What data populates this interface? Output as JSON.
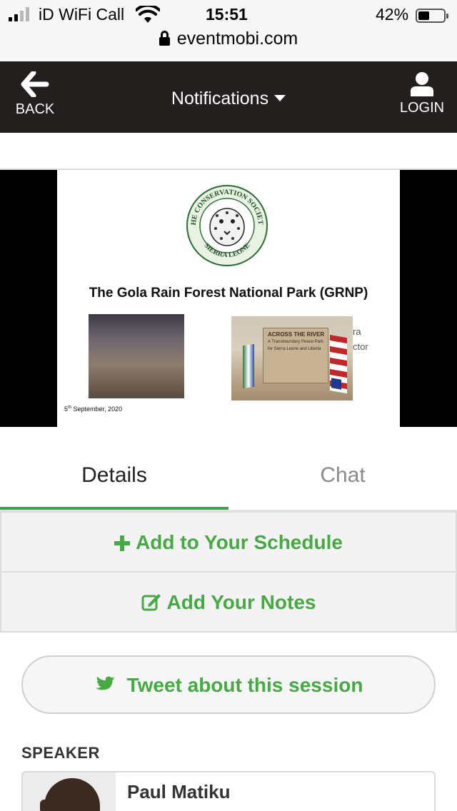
{
  "status_bar": {
    "carrier": "iD WiFi Call",
    "time": "15:51",
    "battery_percent": "42%",
    "battery_level": 0.42,
    "signal_bars_active": 2,
    "signal_bars_total": 4
  },
  "browser": {
    "url": "eventmobi.com"
  },
  "header": {
    "back_label": "BACK",
    "title": "Notifications",
    "login_label": "LOGIN",
    "background_color": "#231f1f"
  },
  "slide": {
    "seal_text_top": "THE CONSERVATION SOCIETY",
    "seal_text_bottom": "SIERRA LEONE",
    "title": "The Gola Rain Forest National Park (GRNP)",
    "sign_text_heading": "ACROSS THE RIVER",
    "sign_text_body": "A Transboundary Peace Park for Sierra Leone and Liberia",
    "partial_text_line1": "ra",
    "partial_text_line2": "ctor",
    "date_day": "5",
    "date_suffix": "th",
    "date_rest": " September, 2020"
  },
  "tabs": [
    {
      "label": "Details",
      "active": true
    },
    {
      "label": "Chat",
      "active": false
    }
  ],
  "actions": {
    "add_schedule": "Add to Your Schedule",
    "add_notes": "Add Your Notes",
    "tweet": "Tweet about this session"
  },
  "speaker": {
    "heading": "SPEAKER",
    "name": "Paul Matiku"
  },
  "colors": {
    "accent_green": "#47a845",
    "tab_indicator": "#3fa34d"
  },
  "icons": {
    "back": "arrow-left-icon",
    "dropdown": "caret-down-icon",
    "login": "user-icon",
    "schedule": "plus-icon",
    "notes": "edit-icon",
    "tweet": "twitter-icon",
    "url": "lock-icon"
  }
}
